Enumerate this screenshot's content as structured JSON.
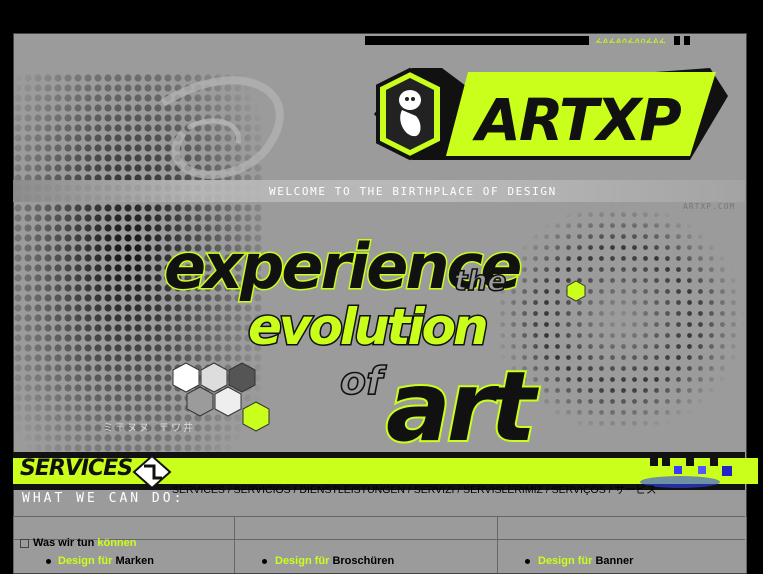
{
  "header": {
    "url": "www.artxp.com",
    "glyph_tag": "ፈልፈልሰፈለሰፈልፈ"
  },
  "logo": {
    "brand": "ARTXP",
    "emblem_icon": "fetus-hexagon-icon"
  },
  "welcome": {
    "text": "WELCOME TO THE BIRTHPLACE OF DESIGN"
  },
  "headline": {
    "line1": "experience",
    "line1b": "the",
    "line2": "evolution",
    "line3a": "of",
    "line3b": "art"
  },
  "services": {
    "title": "SERVICES",
    "languages": "SERVICES / SERVICIOS / DIENSTLEISTUNGEN / SERVIZI / SERVISLERIMIZ / SERVIÇOS / サービス",
    "subtitle": "WHAT WE CAN DO:"
  },
  "table": {
    "row1_label_a": "Was wir tun ",
    "row1_label_b": "können",
    "items": [
      {
        "key": "Design für ",
        "value": "Marken"
      },
      {
        "key": "Design für ",
        "value": "Broschüren"
      },
      {
        "key": "Design für ",
        "value": "Banner"
      }
    ]
  },
  "colors": {
    "accent": "#c9ff1a",
    "background": "#9b9b9b",
    "dark": "#111111"
  }
}
